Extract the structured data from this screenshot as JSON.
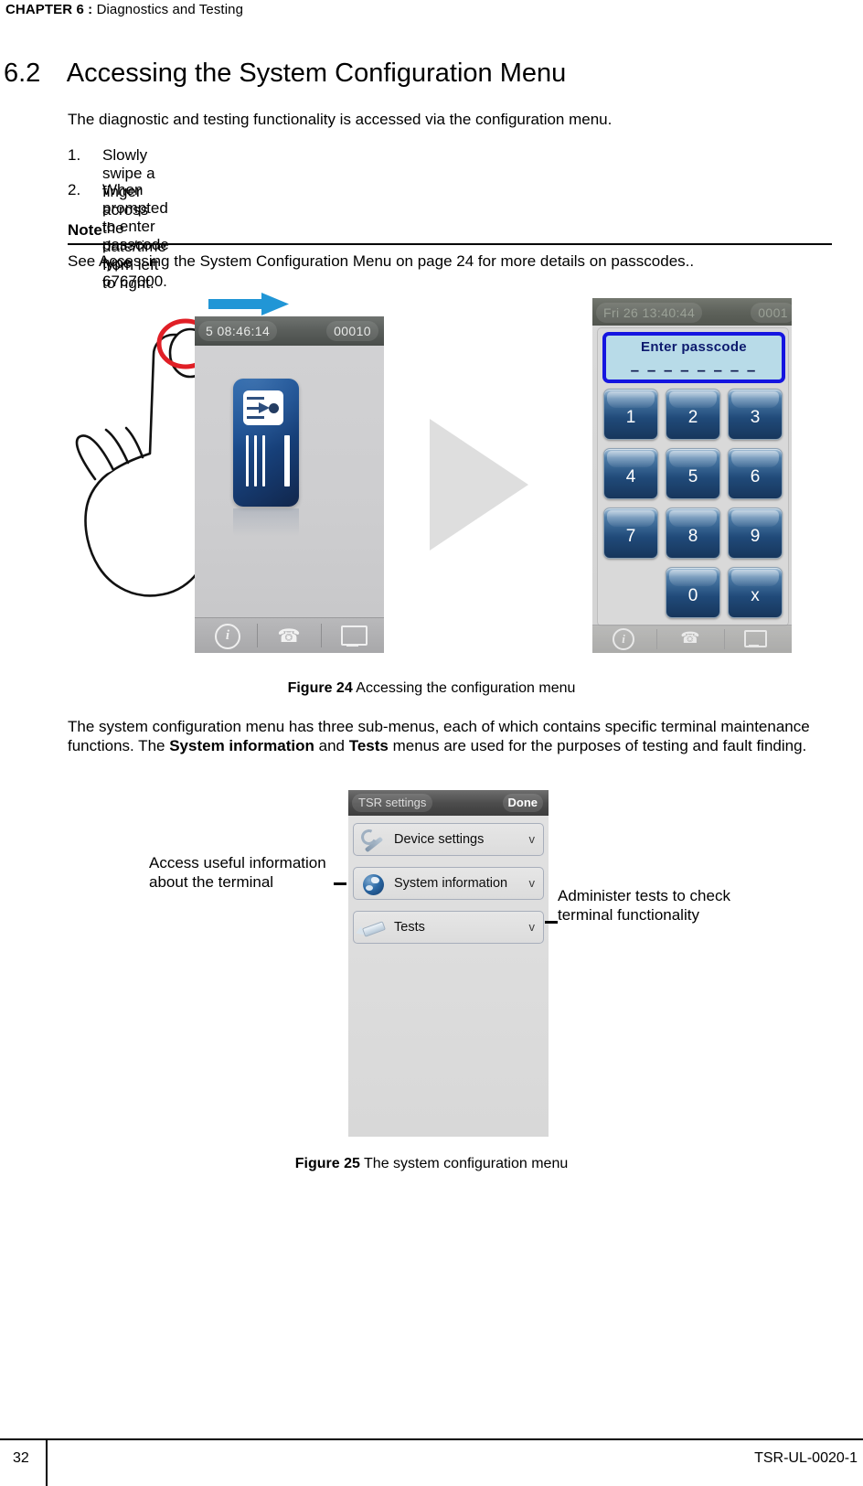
{
  "header": {
    "chapter": "CHAPTER 6 :",
    "title": "Diagnostics and Testing"
  },
  "section": {
    "number": "6.2",
    "title": "Accessing the System Configuration Menu"
  },
  "intro_paragraph": "The diagnostic and testing functionality is accessed via the configuration menu.",
  "steps": [
    {
      "num": "1.",
      "text": "Slowly swipe a finger across the date/time from left to right."
    },
    {
      "num": "2.",
      "text": "When prompted to enter passcode type 6767000."
    }
  ],
  "note": {
    "title": "Note",
    "body": "See Accessing the System Configuration Menu on page 24 for more details on passcodes.."
  },
  "figure24": {
    "caption_label": "Figure 24",
    "caption_text": "Accessing the configuration menu",
    "left_terminal": {
      "date": "5  08:46:14",
      "counter": "00010",
      "toolbar_icons": [
        "info-icon",
        "phone-icon",
        "monitor-icon"
      ]
    },
    "right_terminal": {
      "date": "Fri 26   13:40:44",
      "counter": "0001",
      "passcode_prompt": "Enter passcode",
      "passcode_dashes": "– – – – – – – –",
      "keys": [
        "1",
        "2",
        "3",
        "4",
        "5",
        "6",
        "7",
        "8",
        "9",
        "0",
        "x"
      ]
    }
  },
  "body_paragraph": {
    "part1": "The system configuration menu has three sub-menus, each of which contains specific terminal maintenance functions. The ",
    "bold1": "System information",
    "part2": " and ",
    "bold2": "Tests",
    "part3": " menus are used for the purposes of testing and fault finding."
  },
  "figure25": {
    "caption_label": "Figure 25",
    "caption_text": "The system configuration menu",
    "panel": {
      "title": "TSR settings",
      "done_label": "Done",
      "rows": [
        {
          "label": "Device settings",
          "chevron": "v",
          "icon": "wrench-icon"
        },
        {
          "label": "System information",
          "chevron": "v",
          "icon": "globe-icon"
        },
        {
          "label": "Tests",
          "chevron": "v",
          "icon": "pencil-icon"
        }
      ]
    },
    "callout_left": "Access useful information about the terminal",
    "callout_right": "Administer tests to check terminal functionality"
  },
  "footer": {
    "page_number": "32",
    "doc_id": "TSR-UL-0020-1"
  },
  "colors": {
    "accent_blue": "#1515e0",
    "swipe_arrow": "#2196d6",
    "key_blue": "#17365c"
  }
}
